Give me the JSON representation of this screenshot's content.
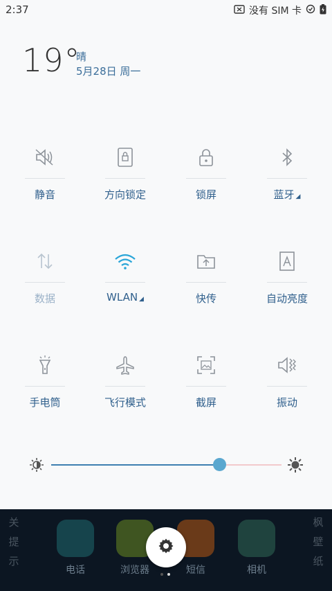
{
  "status_bar": {
    "time": "2:37",
    "sim_text": "没有 SIM 卡"
  },
  "weather": {
    "temperature": "19°",
    "condition": "晴",
    "date": "5月28日 周一"
  },
  "tiles": [
    {
      "label": "静音",
      "icon": "mute-icon"
    },
    {
      "label": "方向锁定",
      "icon": "rotation-lock-icon"
    },
    {
      "label": "锁屏",
      "icon": "lock-icon"
    },
    {
      "label": "蓝牙",
      "icon": "bluetooth-icon"
    },
    {
      "label": "数据",
      "icon": "data-icon"
    },
    {
      "label": "WLAN",
      "icon": "wifi-icon"
    },
    {
      "label": "快传",
      "icon": "share-icon"
    },
    {
      "label": "自动亮度",
      "icon": "auto-brightness-icon"
    },
    {
      "label": "手电筒",
      "icon": "flashlight-icon"
    },
    {
      "label": "飞行模式",
      "icon": "airplane-icon"
    },
    {
      "label": "截屏",
      "icon": "screenshot-icon"
    },
    {
      "label": "振动",
      "icon": "vibrate-icon"
    }
  ],
  "brightness": {
    "level": 0.73
  },
  "dock": {
    "apps": [
      {
        "label": "电话",
        "color": "#1f6b70"
      },
      {
        "label": "浏览器",
        "color": "#6a8a20"
      },
      {
        "label": "短信",
        "color": "#b85a12"
      },
      {
        "label": "相机",
        "color": "#2f6a55"
      }
    ],
    "left_side_text": "关提示",
    "right_side_text": "枫壁纸"
  },
  "colors": {
    "accent": "#2f5f8c",
    "wifi_active": "#29a5d8",
    "panel_bg": "#f8f9fa"
  }
}
